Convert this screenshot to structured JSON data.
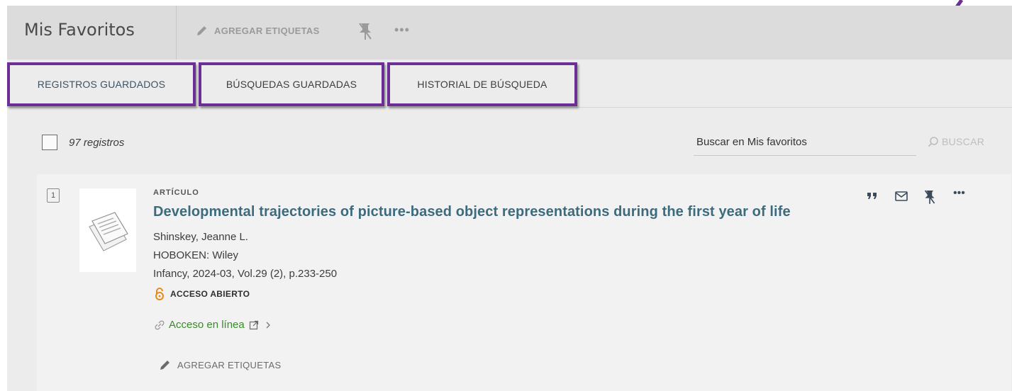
{
  "header": {
    "title": "Mis Favoritos",
    "add_tags_label": "AGREGAR ETIQUETAS",
    "more_label": "•••"
  },
  "tabs": [
    {
      "label": "REGISTROS GUARDADOS",
      "active": true
    },
    {
      "label": "BÚSQUEDAS GUARDADAS",
      "active": false
    },
    {
      "label": "HISTORIAL DE BÚSQUEDA",
      "active": false
    }
  ],
  "toolbar": {
    "records_count": "97 registros",
    "search_placeholder": "Buscar en Mis favoritos",
    "search_button": "BUSCAR"
  },
  "record": {
    "index": "1",
    "type": "ARTÍCULO",
    "title": "Developmental trajectories of picture-based object representations during the first year of life",
    "author": "Shinskey, Jeanne L.",
    "publisher": "HOBOKEN: Wiley",
    "source": "Infancy, 2024-03, Vol.29 (2), p.233-250",
    "open_access": "ACCESO ABIERTO",
    "online_access": "Acceso en línea",
    "add_tags": "AGREGAR ETIQUETAS",
    "more_label": "•••"
  },
  "colors": {
    "highlight": "#6b2f96",
    "link": "#3d6b7e",
    "online": "#3a8a2a",
    "open_access": "#e88a1a"
  },
  "icons": [
    "pencil-icon",
    "unpin-icon",
    "more-icon",
    "search-icon",
    "document-icon",
    "quote-icon",
    "email-icon",
    "open-lock-icon",
    "link-icon",
    "external-link-icon",
    "chevron-right-icon"
  ]
}
